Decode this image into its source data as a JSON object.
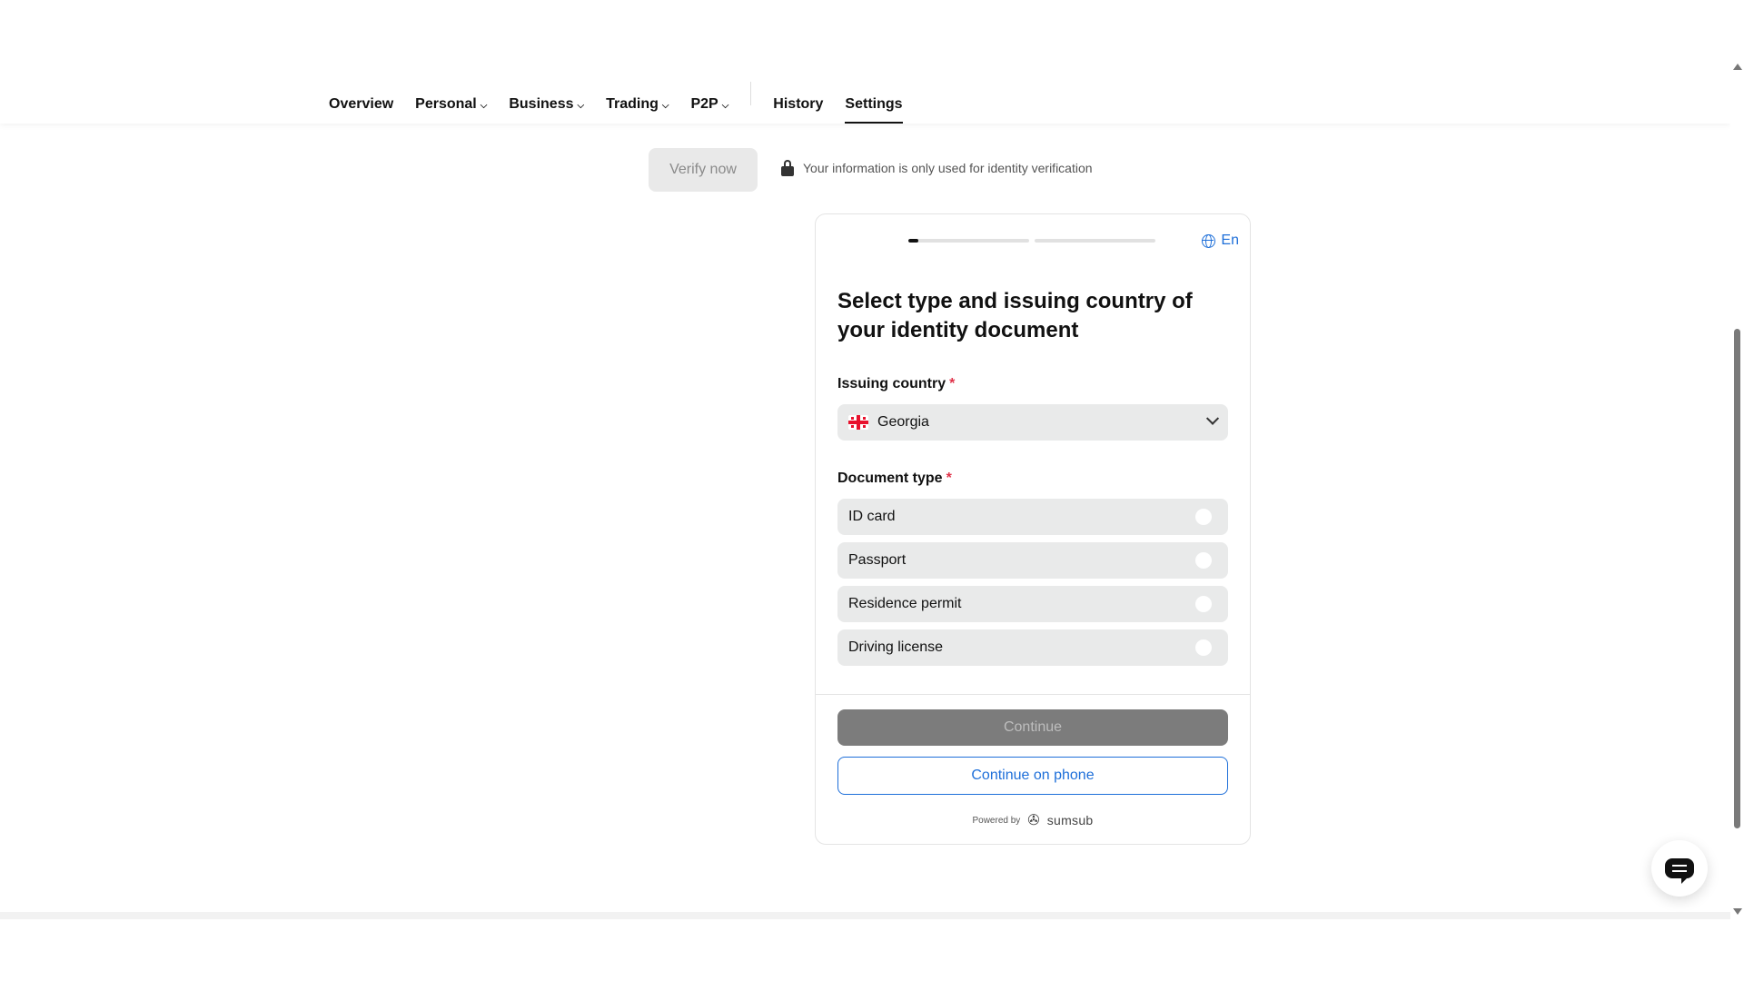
{
  "nav": {
    "items": [
      {
        "label": "Overview",
        "dropdown": false
      },
      {
        "label": "Personal",
        "dropdown": true
      },
      {
        "label": "Business",
        "dropdown": true
      },
      {
        "label": "Trading",
        "dropdown": true
      },
      {
        "label": "P2P",
        "dropdown": true
      }
    ],
    "secondary": [
      {
        "label": "History"
      },
      {
        "label": "Settings",
        "active": true
      }
    ]
  },
  "verify": {
    "button_label": "Verify now",
    "privacy_text": "Your information is only used for identity verification"
  },
  "card": {
    "progress": {
      "step": 1,
      "steps": 2,
      "first_fill_fraction": 0.08
    },
    "language": "En",
    "title": "Select type and issuing country of your identity document",
    "country_label": "Issuing country",
    "required_mark": "*",
    "country_value": "Georgia",
    "document_label": "Document type",
    "document_options": [
      "ID card",
      "Passport",
      "Residence permit",
      "Driving license"
    ],
    "continue_label": "Continue",
    "phone_label": "Continue on phone",
    "powered_by": "Powered by",
    "brand": "sumsub"
  },
  "colors": {
    "accent": "#1e6fd9",
    "required": "#e0334a",
    "disabled_button": "#7c7c7c"
  },
  "icons": [
    "chevron-down-icon",
    "lock-icon",
    "globe-icon",
    "georgia-flag-icon",
    "chat-icon",
    "sumsub-logo-icon"
  ]
}
